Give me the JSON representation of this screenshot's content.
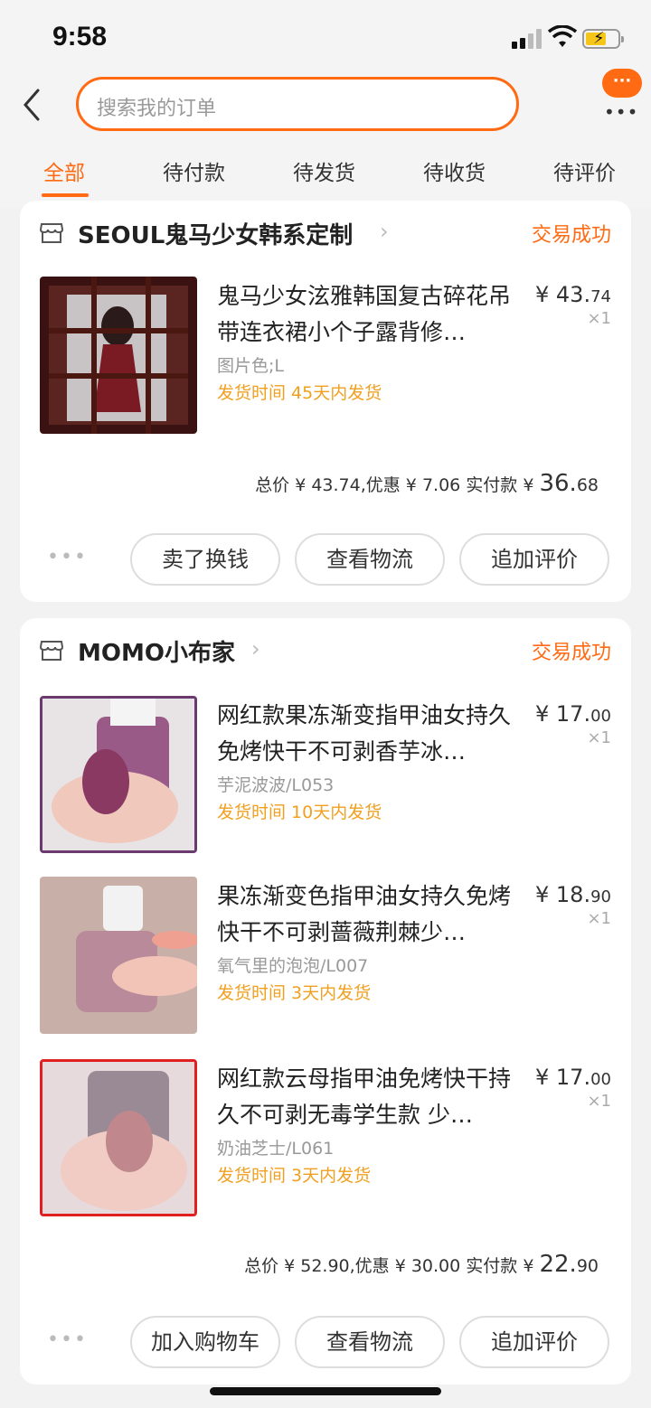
{
  "status_bar": {
    "time": "9:58"
  },
  "header": {
    "search_placeholder": "搜索我的订单",
    "message_badge": "···",
    "more_label": "•••"
  },
  "tabs": [
    {
      "label": "全部",
      "active": true
    },
    {
      "label": "待付款"
    },
    {
      "label": "待发货"
    },
    {
      "label": "待收货"
    },
    {
      "label": "待评价"
    }
  ],
  "orders": [
    {
      "shop": "SEOUL鬼马少女韩系定制",
      "status": "交易成功",
      "items": [
        {
          "title": "鬼马少女泫雅韩国复古碎花吊带连衣裙小个子露背修…",
          "sku": "图片色;L",
          "ship": "发货时间  45天内发货",
          "price_int": "¥ 43.",
          "price_dec": "74",
          "qty": "×1"
        }
      ],
      "total_prefix": "总价 ¥ 43.74,优惠 ¥ 7.06  实付款 ¥ ",
      "total_big": "36.",
      "total_small": "68",
      "buttons": [
        "卖了换钱",
        "查看物流",
        "追加评价"
      ]
    },
    {
      "shop": "MOMO小布家",
      "status": "交易成功",
      "items": [
        {
          "title": "网红款果冻渐变指甲油女持久免烤快干不可剥香芋冰…",
          "sku": "芋泥波波/L053",
          "ship": "发货时间  10天内发货",
          "price_int": "¥ 17.",
          "price_dec": "00",
          "qty": "×1"
        },
        {
          "title": "果冻渐变色指甲油女持久免烤快干不可剥蔷薇荆棘少…",
          "sku": "氧气里的泡泡/L007",
          "ship": "发货时间  3天内发货",
          "price_int": "¥ 18.",
          "price_dec": "90",
          "qty": "×1"
        },
        {
          "title": "网红款云母指甲油免烤快干持久不可剥无毒学生款 少…",
          "sku": "奶油芝士/L061",
          "ship": "发货时间  3天内发货",
          "price_int": "¥ 17.",
          "price_dec": "00",
          "qty": "×1"
        }
      ],
      "total_prefix": "总价 ¥ 52.90,优惠 ¥ 30.00  实付款 ¥ ",
      "total_big": "22.",
      "total_small": "90",
      "buttons": [
        "加入购物车",
        "查看物流",
        "追加评价"
      ]
    }
  ],
  "colors": {
    "accent": "#ff6a12",
    "ship_text": "#f0a020"
  }
}
